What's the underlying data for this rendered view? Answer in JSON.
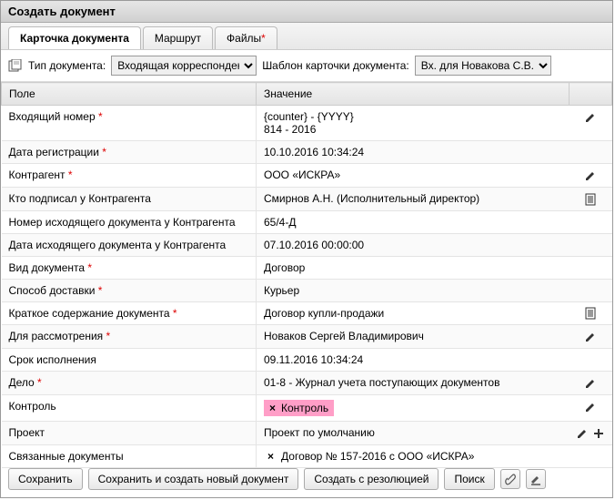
{
  "window_title": "Создать документ",
  "tabs": [
    {
      "label": "Карточка документа",
      "active": true
    },
    {
      "label": "Маршрут",
      "active": false
    },
    {
      "label": "Файлы",
      "required": true,
      "active": false
    }
  ],
  "doc_type_label": "Тип документа:",
  "doc_type_value": "Входящая корреспонденция",
  "template_label": "Шаблон карточки документа:",
  "template_value": "Вх. для Новакова С.В.",
  "columns": {
    "field": "Поле",
    "value": "Значение"
  },
  "rows": [
    {
      "field": "Входящий номер",
      "required": true,
      "value": "{counter} - {YYYY}",
      "value2": "814 - 2016",
      "action": "edit"
    },
    {
      "field": "Дата регистрации",
      "required": true,
      "value": "10.10.2016 10:34:24",
      "action": ""
    },
    {
      "field": "Контрагент",
      "required": true,
      "value": "ООО «ИСКРА»",
      "action": "edit"
    },
    {
      "field": "Кто подписал у Контрагента",
      "required": false,
      "value": "Смирнов А.Н. (Исполнительный директор)",
      "action": "form"
    },
    {
      "field": "Номер исходящего документа у Контрагента",
      "required": false,
      "value": "65/4-Д",
      "action": ""
    },
    {
      "field": "Дата исходящего документа у Контрагента",
      "required": false,
      "value": "07.10.2016 00:00:00",
      "action": ""
    },
    {
      "field": "Вид документа",
      "required": true,
      "value": "Договор",
      "action": ""
    },
    {
      "field": "Способ доставки",
      "required": true,
      "value": "Курьер",
      "action": ""
    },
    {
      "field": "Краткое содержание документа",
      "required": true,
      "value": "Договор купли-продажи",
      "action": "form"
    },
    {
      "field": "Для рассмотрения",
      "required": true,
      "value": "Новаков Сергей Владимирович",
      "action": "edit"
    },
    {
      "field": "Срок исполнения",
      "required": false,
      "value": "09.11.2016 10:34:24",
      "action": ""
    },
    {
      "field": "Дело",
      "required": true,
      "value": "01-8 - Журнал учета поступающих документов",
      "action": "edit"
    },
    {
      "field": "Контроль",
      "required": false,
      "value": "Контроль",
      "badge": true,
      "action": "edit"
    },
    {
      "field": "Проект",
      "required": false,
      "value": "Проект по умолчанию",
      "action": "edit-plus"
    },
    {
      "field": "Связанные документы",
      "required": false,
      "value": "",
      "linked": "Договор № 157-2016 с ООО «ИСКРА»",
      "action": ""
    }
  ],
  "buttons": {
    "save": "Сохранить",
    "save_new": "Сохранить и создать новый документ",
    "create_res": "Создать с резолюцией",
    "search": "Поиск"
  }
}
